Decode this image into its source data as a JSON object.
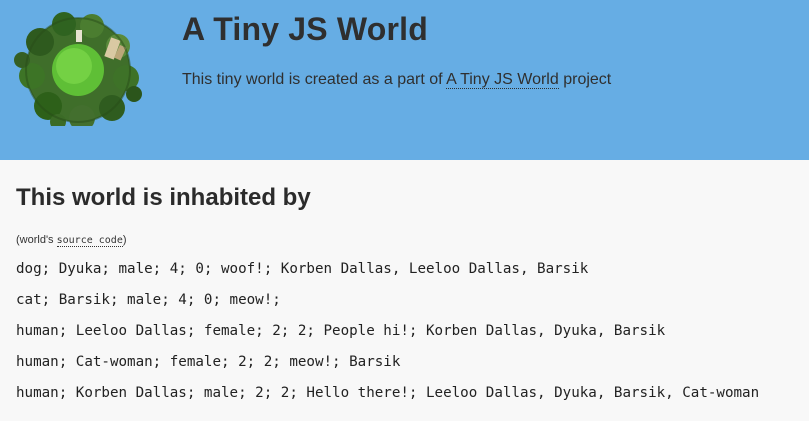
{
  "header": {
    "title": "A Tiny JS World",
    "description_prefix": "This tiny world is created as a part of ",
    "link_text": "A Tiny JS World",
    "description_suffix": " project",
    "logo_icon": "tiny-planet-logo-icon"
  },
  "main": {
    "title": "This world is inhabited by",
    "source_prefix": "(world's ",
    "source_link": "source code",
    "source_suffix": ")",
    "inhabitants": [
      "dog; Dyuka; male; 4; 0; woof!; Korben Dallas, Leeloo Dallas, Barsik",
      "cat; Barsik; male; 4; 0; meow!;",
      "human; Leeloo Dallas; female; 2; 2; People hi!; Korben Dallas, Dyuka, Barsik",
      "human; Cat-woman; female; 2; 2; meow!; Barsik",
      "human; Korben Dallas; male; 2; 2; Hello there!; Leeloo Dallas, Dyuka, Barsik, Cat-woman"
    ]
  },
  "colors": {
    "header_bg": "#66ade4",
    "page_bg": "#f8f8f8",
    "text": "#333333"
  }
}
